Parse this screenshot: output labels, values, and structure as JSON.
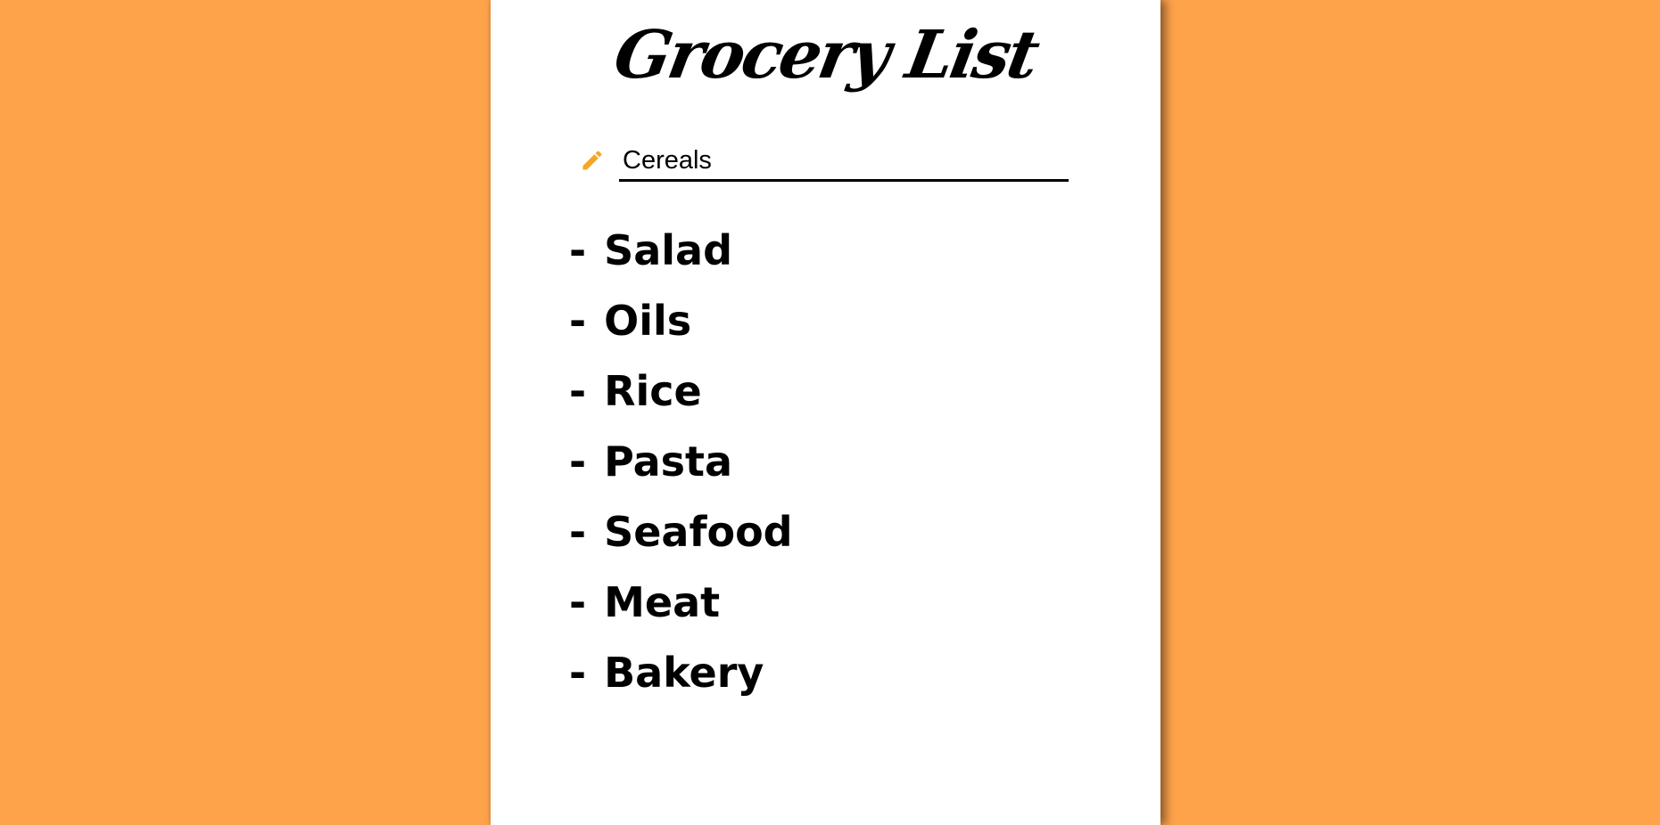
{
  "app": {
    "title": "Grocery List",
    "accent_color": "#f5a623",
    "background_color": "#ffa34b"
  },
  "input": {
    "icon": "pencil-icon",
    "value": "Cereals"
  },
  "items": [
    {
      "dash": "-",
      "label": "Salad",
      "done": false
    },
    {
      "dash": "-",
      "label": "Oils",
      "done": true
    },
    {
      "dash": "-",
      "label": "Rice",
      "done": true
    },
    {
      "dash": "-",
      "label": "Pasta",
      "done": false
    },
    {
      "dash": "-",
      "label": "Seafood",
      "done": false
    },
    {
      "dash": "-",
      "label": "Meat",
      "done": true
    },
    {
      "dash": "-",
      "label": "Bakery",
      "done": false
    }
  ]
}
